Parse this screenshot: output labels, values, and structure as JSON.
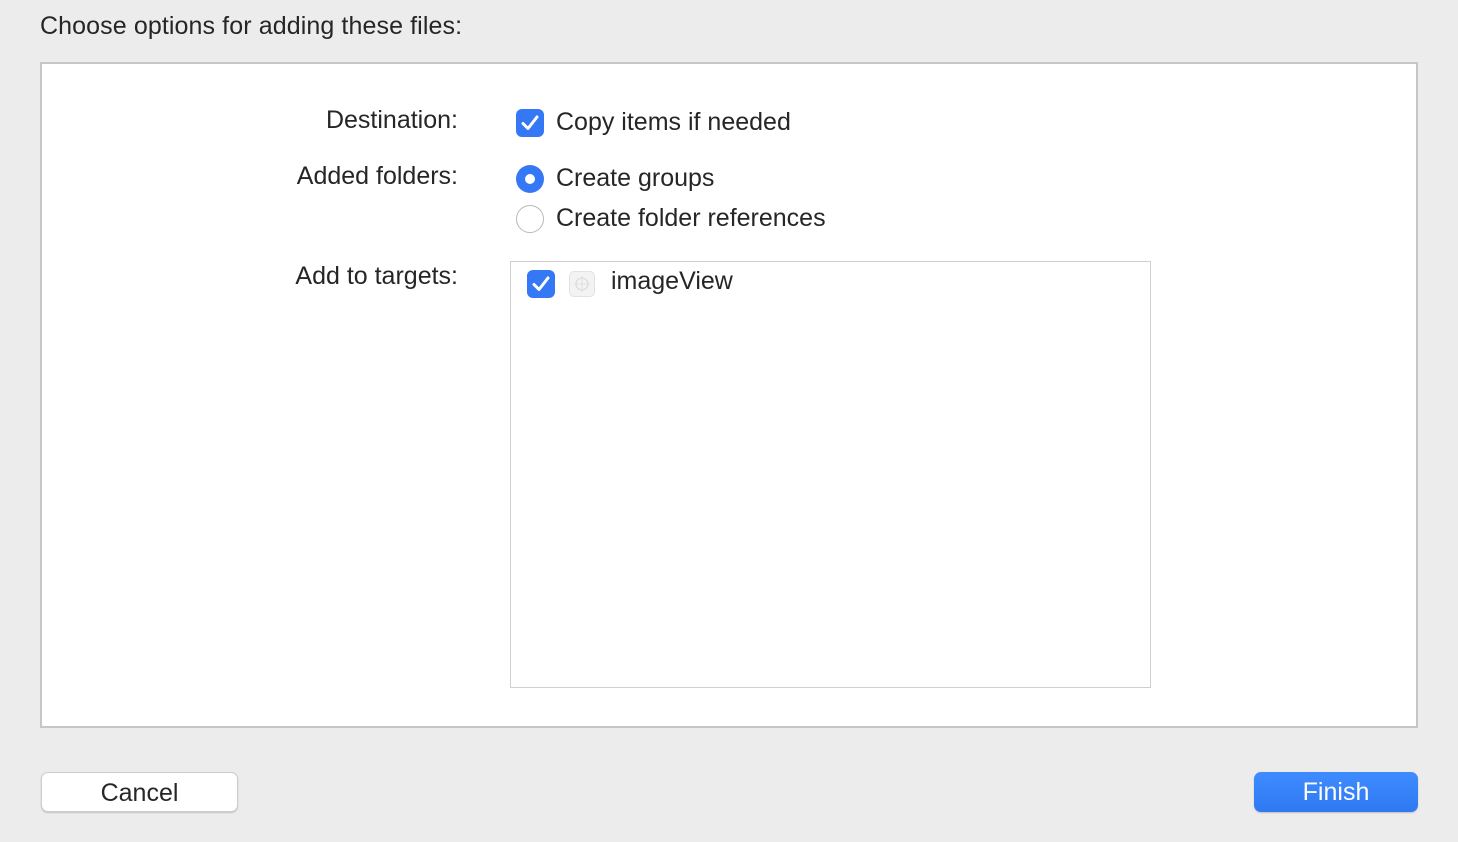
{
  "dialog": {
    "heading": "Choose options for adding these files:"
  },
  "destination": {
    "label": "Destination:",
    "option_label": "Copy items if needed",
    "checked": true
  },
  "added_folders": {
    "label": "Added folders:",
    "options": [
      {
        "label": "Create groups",
        "selected": true
      },
      {
        "label": "Create folder references",
        "selected": false
      }
    ]
  },
  "targets": {
    "label": "Add to targets:",
    "items": [
      {
        "name": "imageView",
        "checked": true,
        "icon": "app-target-icon"
      }
    ]
  },
  "buttons": {
    "cancel_label": "Cancel",
    "finish_label": "Finish"
  },
  "colors": {
    "accent": "#3478f6",
    "panel_background": "#ffffff",
    "window_background": "#ececec"
  }
}
